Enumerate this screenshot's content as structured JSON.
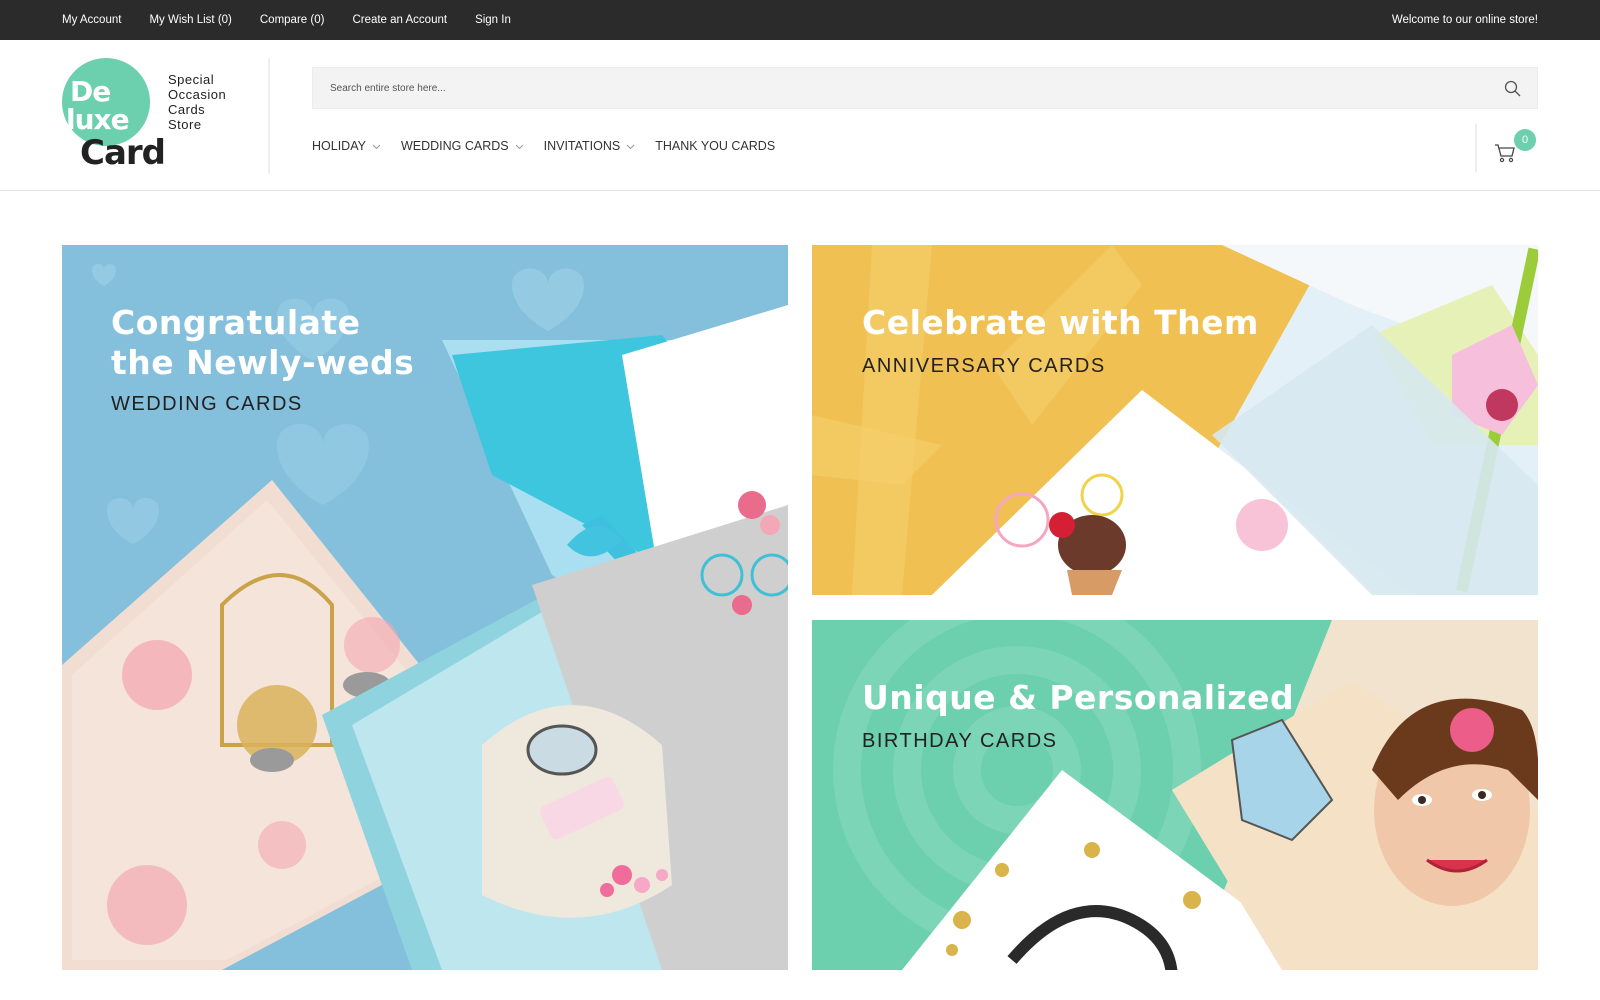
{
  "topbar": {
    "links": [
      "My Account",
      "My Wish List (0)",
      "Compare (0)",
      "Create an Account",
      "Sign In"
    ],
    "welcome": "Welcome to our online store!"
  },
  "logo": {
    "line1": "De",
    "line2": "luxe",
    "line3": "Card",
    "tagline": [
      "Special",
      "Occasion",
      "Cards",
      "Store"
    ],
    "accent_color": "#6ccfae"
  },
  "search": {
    "placeholder": "Search entire store here...",
    "icon": "search-icon"
  },
  "nav": {
    "items": [
      {
        "label": "HOLIDAY",
        "has_dropdown": true
      },
      {
        "label": "WEDDING CARDS",
        "has_dropdown": true
      },
      {
        "label": "INVITATIONS",
        "has_dropdown": true
      },
      {
        "label": "THANK YOU CARDS",
        "has_dropdown": false
      }
    ]
  },
  "cart": {
    "count": "0",
    "icon": "cart-icon"
  },
  "banners": [
    {
      "title_line1": "Congratulate",
      "title_line2": "the Newly-weds",
      "subtitle": "WEDDING CARDS",
      "color": "#84bfdc"
    },
    {
      "title_line1": "Celebrate with Them",
      "subtitle": "ANNIVERSARY CARDS",
      "color": "#f0c152"
    },
    {
      "title_line1": "Unique & Personalized",
      "subtitle": "BIRTHDAY CARDS",
      "color": "#6ccfae"
    }
  ]
}
